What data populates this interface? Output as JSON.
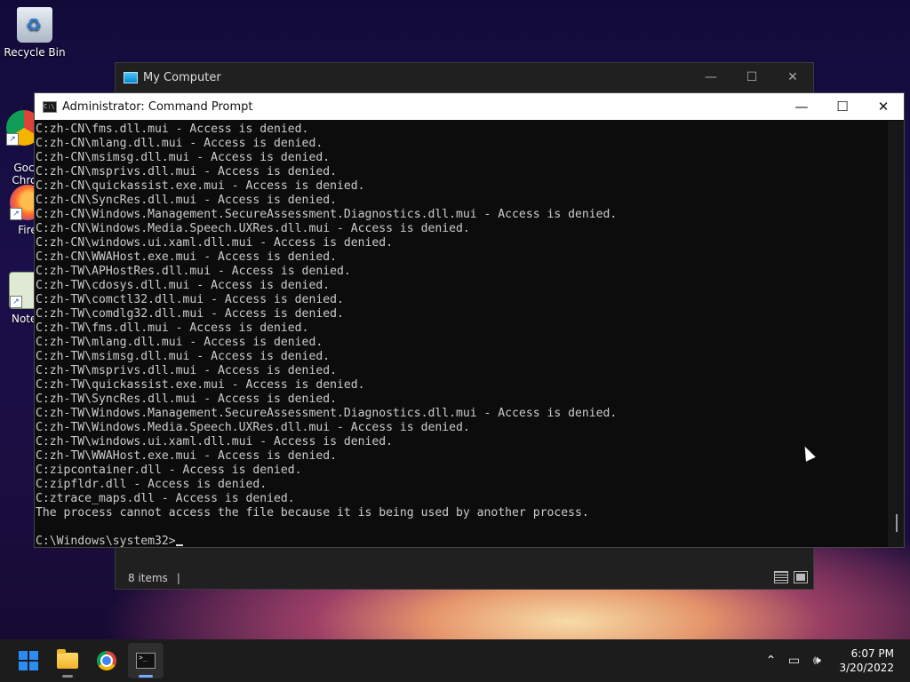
{
  "desktop": {
    "icons": [
      {
        "label": "Recycle Bin"
      },
      {
        "label": "Goc\nChrc"
      },
      {
        "label": "Fire"
      },
      {
        "label": "Notep"
      }
    ]
  },
  "explorer": {
    "title": "My Computer",
    "status_items": "8 items",
    "status_sep": "|"
  },
  "cmd": {
    "title": "Administrator: Command Prompt",
    "lines": [
      "C:zh-CN\\fms.dll.mui - Access is denied.",
      "C:zh-CN\\mlang.dll.mui - Access is denied.",
      "C:zh-CN\\msimsg.dll.mui - Access is denied.",
      "C:zh-CN\\msprivs.dll.mui - Access is denied.",
      "C:zh-CN\\quickassist.exe.mui - Access is denied.",
      "C:zh-CN\\SyncRes.dll.mui - Access is denied.",
      "C:zh-CN\\Windows.Management.SecureAssessment.Diagnostics.dll.mui - Access is denied.",
      "C:zh-CN\\Windows.Media.Speech.UXRes.dll.mui - Access is denied.",
      "C:zh-CN\\windows.ui.xaml.dll.mui - Access is denied.",
      "C:zh-CN\\WWAHost.exe.mui - Access is denied.",
      "C:zh-TW\\APHostRes.dll.mui - Access is denied.",
      "C:zh-TW\\cdosys.dll.mui - Access is denied.",
      "C:zh-TW\\comctl32.dll.mui - Access is denied.",
      "C:zh-TW\\comdlg32.dll.mui - Access is denied.",
      "C:zh-TW\\fms.dll.mui - Access is denied.",
      "C:zh-TW\\mlang.dll.mui - Access is denied.",
      "C:zh-TW\\msimsg.dll.mui - Access is denied.",
      "C:zh-TW\\msprivs.dll.mui - Access is denied.",
      "C:zh-TW\\quickassist.exe.mui - Access is denied.",
      "C:zh-TW\\SyncRes.dll.mui - Access is denied.",
      "C:zh-TW\\Windows.Management.SecureAssessment.Diagnostics.dll.mui - Access is denied.",
      "C:zh-TW\\Windows.Media.Speech.UXRes.dll.mui - Access is denied.",
      "C:zh-TW\\windows.ui.xaml.dll.mui - Access is denied.",
      "C:zh-TW\\WWAHost.exe.mui - Access is denied.",
      "C:zipcontainer.dll - Access is denied.",
      "C:zipfldr.dll - Access is denied.",
      "C:ztrace_maps.dll - Access is denied.",
      "The process cannot access the file because it is being used by another process.",
      ""
    ],
    "prompt": "C:\\Windows\\system32>"
  },
  "window_controls": {
    "minimize": "—",
    "maximize": "☐",
    "close": "✕"
  },
  "taskbar": {
    "apps": [
      "start-icon",
      "file-explorer-icon",
      "chrome-icon",
      "terminal-icon"
    ],
    "tray": {
      "chevron": "⌃",
      "network": "▭",
      "volume": "🕪"
    },
    "time": "6:07 PM",
    "date": "3/20/2022"
  }
}
